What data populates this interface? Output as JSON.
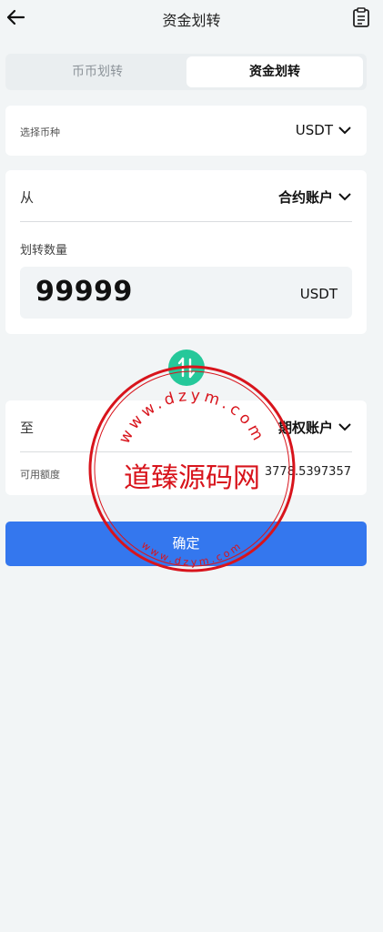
{
  "header": {
    "title": "资金划转"
  },
  "tabs": [
    {
      "label": "币币划转",
      "active": false
    },
    {
      "label": "资金划转",
      "active": true
    }
  ],
  "coin": {
    "label": "选择币种",
    "value": "USDT"
  },
  "from": {
    "label": "从",
    "account": "合约账户"
  },
  "quantity": {
    "label": "划转数量",
    "value": "99999",
    "unit": "USDT"
  },
  "to": {
    "label": "至",
    "account": "期权账户"
  },
  "available": {
    "label": "可用额度",
    "value": "3778.5397357"
  },
  "confirm": {
    "label": "确定"
  },
  "watermark": {
    "text": "道臻源码网",
    "ring_top": "www.dzym.com",
    "ring_bottom": "www.dzym.com"
  },
  "colors": {
    "accent": "#3477ee",
    "swap": "#25c89a",
    "stamp": "#d8141c",
    "background": "#f2f5f6"
  },
  "icons": {
    "back": "arrow-left-icon",
    "clipboard": "clipboard-icon",
    "caret": "chevron-down-icon",
    "swap": "swap-arrows-icon"
  }
}
